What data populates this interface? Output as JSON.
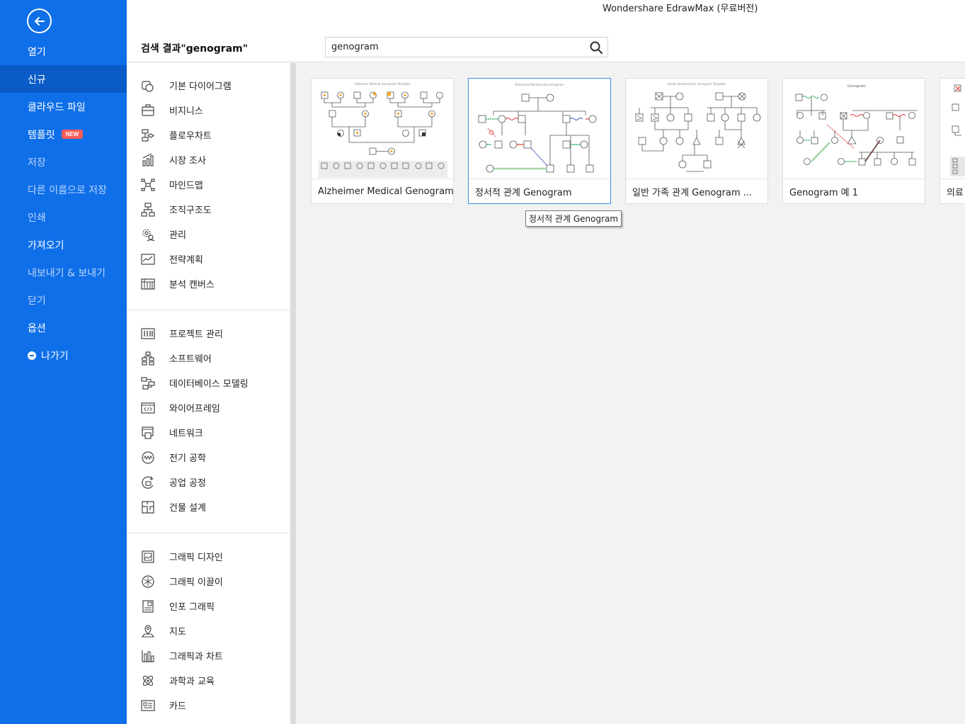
{
  "window": {
    "title": "Wondershare EdrawMax (무료버전)"
  },
  "rail": {
    "back_icon": "arrow-left-icon",
    "items": [
      {
        "label": "열기",
        "state": "normal"
      },
      {
        "label": "신규",
        "state": "active"
      },
      {
        "label": "클라우드 파일",
        "state": "normal"
      },
      {
        "label": "템플릿",
        "state": "normal",
        "badge": "NEW"
      },
      {
        "label": "저장",
        "state": "dim"
      },
      {
        "label": "다른 이름으로 저장",
        "state": "dim"
      },
      {
        "label": "인쇄",
        "state": "dim"
      },
      {
        "label": "가져오기",
        "state": "normal"
      },
      {
        "label": "내보내기 & 보내기",
        "state": "dim"
      },
      {
        "label": "닫기",
        "state": "dim"
      },
      {
        "label": "옵션",
        "state": "normal"
      },
      {
        "label": "나가기",
        "state": "normal"
      }
    ],
    "colors": {
      "background": "#0f6fe8",
      "active": "#0a5bc6",
      "dim_text": "#bcd5fb",
      "badge": "#ff5b57"
    }
  },
  "search": {
    "heading": "검색 결과\"genogram\"",
    "value": "genogram",
    "icon": "search-icon"
  },
  "categories": {
    "group1": [
      {
        "label": "기본 다이어그램",
        "icon": "basic-diagram-icon"
      },
      {
        "label": "비지니스",
        "icon": "briefcase-icon"
      },
      {
        "label": "플로우차트",
        "icon": "flowchart-icon"
      },
      {
        "label": "시장 조사",
        "icon": "bar-chart-icon"
      },
      {
        "label": "마인드맵",
        "icon": "mindmap-icon"
      },
      {
        "label": "조직구조도",
        "icon": "org-chart-icon"
      },
      {
        "label": "관리",
        "icon": "management-gear-icon"
      },
      {
        "label": "전략계획",
        "icon": "strategy-icon"
      },
      {
        "label": "분석 캔버스",
        "icon": "canvas-icon"
      }
    ],
    "group2": [
      {
        "label": "프로젝트 관리",
        "icon": "project-icon"
      },
      {
        "label": "소프트웨어",
        "icon": "software-icon"
      },
      {
        "label": "데이터베이스 모델링",
        "icon": "database-icon"
      },
      {
        "label": "와이어프레임",
        "icon": "wireframe-icon"
      },
      {
        "label": "네트워크",
        "icon": "network-icon"
      },
      {
        "label": "전기 공학",
        "icon": "electrical-icon"
      },
      {
        "label": "공업 공정",
        "icon": "industrial-icon"
      },
      {
        "label": "건물 설계",
        "icon": "floorplan-icon"
      }
    ],
    "group3": [
      {
        "label": "그래픽 디자인",
        "icon": "graphic-design-icon"
      },
      {
        "label": "그래픽 이끌이",
        "icon": "graphic-organizer-icon"
      },
      {
        "label": "인포 그래픽",
        "icon": "infographic-icon"
      },
      {
        "label": "지도",
        "icon": "map-pin-icon"
      },
      {
        "label": "그래픽과 차트",
        "icon": "chart-icon"
      },
      {
        "label": "과학과 교육",
        "icon": "atom-icon"
      },
      {
        "label": "카드",
        "icon": "card-icon"
      }
    ]
  },
  "templates": [
    {
      "label": "Alzheimer Medical Genogram",
      "thumb_title": "Alzheimer Medical Genogram Template",
      "selected": false
    },
    {
      "label": "정서적 관계 Genogram",
      "thumb_title": "Emotional Relationship Genogram",
      "selected": true
    },
    {
      "label": "일반 가족 관계 Genogram ...",
      "thumb_title": "Family Relationships Genogram Template",
      "selected": false
    },
    {
      "label": "Genogram 예 1",
      "thumb_title": "Genogram",
      "selected": false
    },
    {
      "label": "의료",
      "thumb_title": "",
      "selected": false
    }
  ],
  "tooltip": "정서적 관계 Genogram"
}
